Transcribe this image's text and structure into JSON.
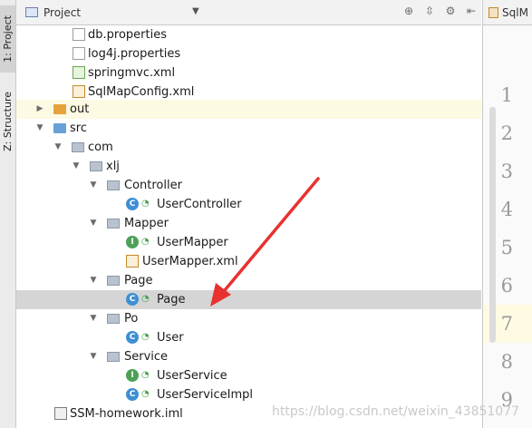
{
  "sidebar": {
    "tabs": [
      {
        "label": "1: Project"
      },
      {
        "label": "Z: Structure"
      }
    ]
  },
  "header": {
    "title": "Project",
    "tools": [
      "crosshair-icon",
      "collapse-icon",
      "gear-icon",
      "hide-icon"
    ]
  },
  "editor": {
    "tab_label": "SqlM",
    "line_numbers": [
      "1",
      "2",
      "3",
      "4",
      "5",
      "6",
      "7",
      "8",
      "9"
    ]
  },
  "tree": {
    "items": [
      {
        "label": "db.properties",
        "icon": "properties-file-icon"
      },
      {
        "label": "log4j.properties",
        "icon": "properties-file-icon"
      },
      {
        "label": "springmvc.xml",
        "icon": "spring-xml-icon"
      },
      {
        "label": "SqlMapConfig.xml",
        "icon": "xml-file-icon"
      },
      {
        "label": "out",
        "icon": "folder-icon"
      },
      {
        "label": "src",
        "icon": "folder-icon"
      },
      {
        "label": "com",
        "icon": "package-icon"
      },
      {
        "label": "xlj",
        "icon": "package-icon"
      },
      {
        "label": "Controller",
        "icon": "package-icon"
      },
      {
        "label": "UserController",
        "icon": "class-icon"
      },
      {
        "label": "Mapper",
        "icon": "package-icon"
      },
      {
        "label": "UserMapper",
        "icon": "interface-icon"
      },
      {
        "label": "UserMapper.xml",
        "icon": "xml-file-icon"
      },
      {
        "label": "Page",
        "icon": "package-icon"
      },
      {
        "label": "Page",
        "icon": "class-icon"
      },
      {
        "label": "Po",
        "icon": "package-icon"
      },
      {
        "label": "User",
        "icon": "class-icon"
      },
      {
        "label": "Service",
        "icon": "package-icon"
      },
      {
        "label": "UserService",
        "icon": "interface-icon"
      },
      {
        "label": "UserServiceImpl",
        "icon": "class-icon"
      },
      {
        "label": "SSM-homework.iml",
        "icon": "iml-file-icon"
      }
    ]
  },
  "watermark": "https://blog.csdn.net/weixin_43851077",
  "colors": {
    "selection": "#d5d5d5",
    "highlight": "#fdfae3",
    "annotation_arrow": "#e8322f"
  }
}
